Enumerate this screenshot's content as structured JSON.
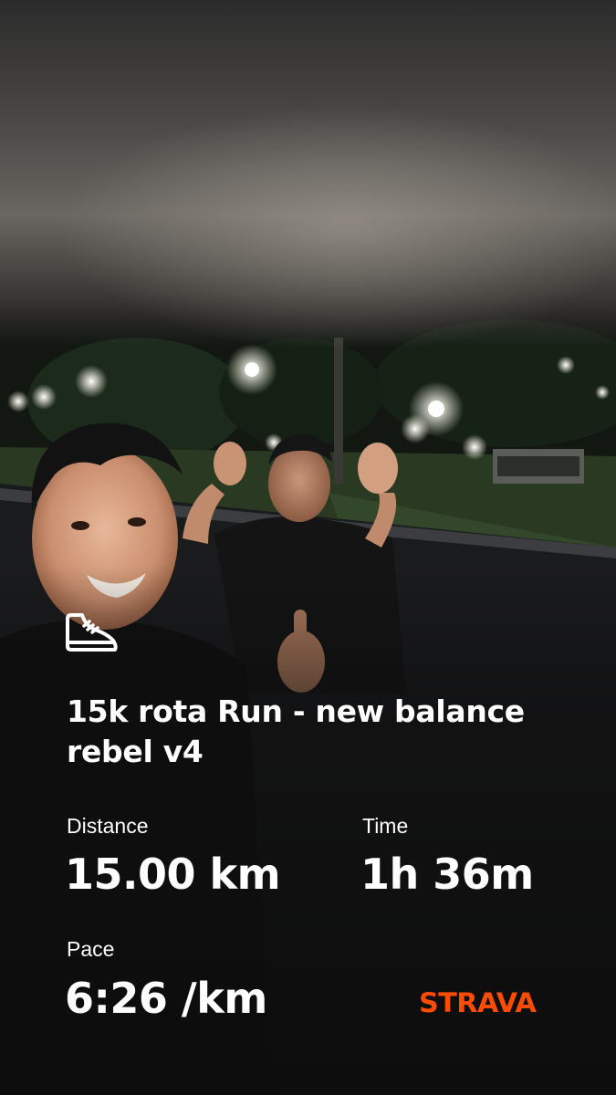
{
  "activity": {
    "title": "15k rota Run - new balance rebel v4",
    "sport_icon": "running-shoe-icon"
  },
  "stats": {
    "distance": {
      "label": "Distance",
      "value": "15.00 km"
    },
    "time": {
      "label": "Time",
      "value": "1h 36m"
    },
    "pace": {
      "label": "Pace",
      "value": "6:26 /km"
    }
  },
  "brand": {
    "name": "STRAVA",
    "color": "#fc4c02"
  },
  "colors": {
    "text": "#ffffff",
    "background": "#0c0c0c"
  }
}
